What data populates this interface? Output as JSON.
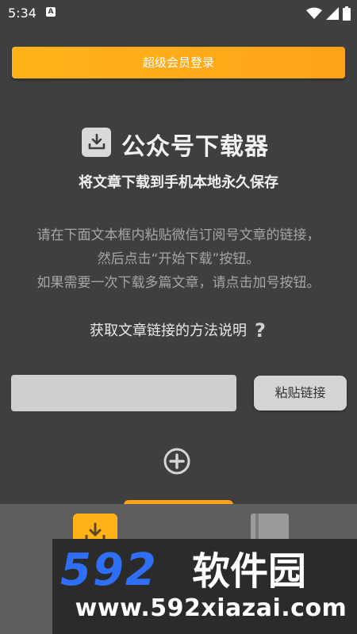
{
  "status_bar": {
    "time": "5:34",
    "notification_badge": "A",
    "icons": [
      "wifi-icon",
      "signal-icon",
      "battery-icon"
    ]
  },
  "vip_button": {
    "label": "超级会员登录"
  },
  "app": {
    "title": "公众号下载器",
    "subtitle": "将文章下载到手机本地永久保存",
    "logo_icon": "download-icon"
  },
  "instructions": [
    "请在下面文本框内粘贴微信订阅号文章的链接，",
    "然后点击“开始下载”按钮。",
    "如果需要一次下载多篇文章，请点击加号按钮。"
  ],
  "help": {
    "label": "获取文章链接的方法说明",
    "icon": "question-icon"
  },
  "link_input": {
    "value": "",
    "placeholder": ""
  },
  "paste_button": {
    "label": "粘贴链接"
  },
  "add_button": {
    "icon": "add-circle-icon"
  },
  "bottom_nav": {
    "items": [
      {
        "icon": "download-icon",
        "active": true
      },
      {
        "icon": "book-icon",
        "active": false
      }
    ]
  },
  "watermark": {
    "logo_text": "592软件园",
    "url": "www.592xiazai.com"
  },
  "colors": {
    "background": "#3f3f3f",
    "accent": "#ffa319",
    "nav_background": "#5e5e5e",
    "watermark_blue": "#2f6ff5"
  }
}
